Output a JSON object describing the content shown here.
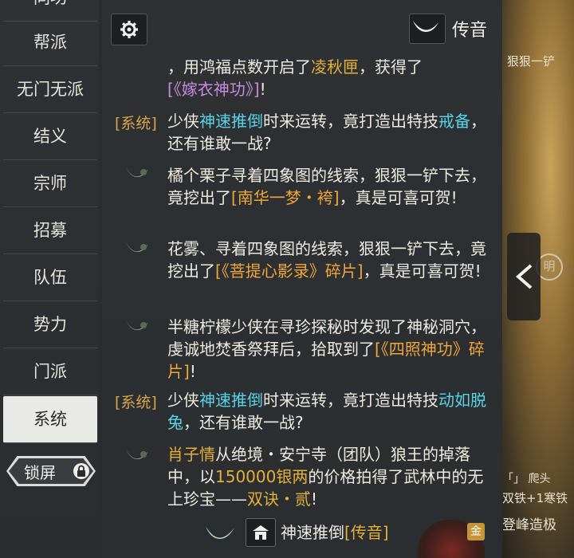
{
  "sidebar": {
    "items": [
      {
        "label": "同功"
      },
      {
        "label": "帮派"
      },
      {
        "label": "无门无派"
      },
      {
        "label": "结义"
      },
      {
        "label": "宗师"
      },
      {
        "label": "招募"
      },
      {
        "label": "队伍"
      },
      {
        "label": "势力"
      },
      {
        "label": "门派"
      },
      {
        "label": "系统"
      }
    ],
    "active_index": 9,
    "lock_label": "锁屏"
  },
  "header": {
    "horn_label": "传音"
  },
  "messages": {
    "m0": {
      "text_a": "，用鸿福点数开启了",
      "link_a": "凌秋匣",
      "text_b": "，获得了",
      "link_b": "[《嫁衣神功》]",
      "text_c": "!"
    },
    "m1": {
      "tag": "[系统]",
      "text_a": "少侠",
      "name": "神速推倒",
      "text_b": "时来运转，竟打造出特技",
      "item": "戒备",
      "text_c": "，还有谁敢一战?"
    },
    "m2": {
      "text_a": "橘个栗子寻着四象图的线索，狠狠一铲下去，竟挖出了",
      "item": "[南华一梦・袴]",
      "text_b": "，真是可喜可贺!"
    },
    "m3": {
      "text_a": "花雾、寻着四象图的线索，狠狠一铲下去，竟挖出了",
      "item": "[《菩提心影录》碎片]",
      "text_b": "，真是可喜可贺!"
    },
    "m4": {
      "text_a": "半糖柠檬少侠在寻珍探秘时发现了神秘洞穴，虔诚地焚香祭拜后，拾取到了",
      "item": "[《四照神功》碎片]",
      "text_b": "!"
    },
    "m5": {
      "tag": "[系统]",
      "text_a": "少侠",
      "name": "神速推倒",
      "text_b": "时来运转，竟打造出特技",
      "item": "动如脱兔",
      "text_c": "，还有谁敢一战?"
    },
    "m6": {
      "name": "肖子情",
      "text_a": "从绝境・安宁寺（团队）狼王的掉落中，以",
      "price": "150000银两",
      "text_b": "的价格拍得了武林中的无上珍宝——",
      "item": "双诀・贰",
      "text_c": "!"
    }
  },
  "footer": {
    "sender_name": "神速推倒",
    "sender_channel": "[传音]",
    "badge": "金"
  },
  "world": {
    "top_text": "狠狠一铲",
    "moon_glyph": "明",
    "line1": "「」 爬头",
    "line2": "双铁+1寒铁",
    "line3": "登峰造极"
  }
}
